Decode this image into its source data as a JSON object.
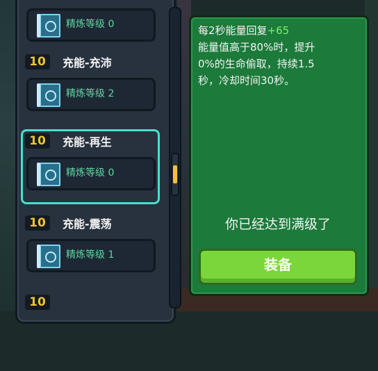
{
  "list": {
    "cards": [
      {
        "level": "",
        "name": "",
        "refine_label": "精炼等级 0"
      },
      {
        "level": "10",
        "name": "充能-充沛",
        "refine_label": "精炼等级 2"
      },
      {
        "level": "10",
        "name": "充能-再生",
        "refine_label": "精炼等级 0"
      },
      {
        "level": "10",
        "name": "充能-震荡",
        "refine_label": "精炼等级 1"
      },
      {
        "level": "10",
        "name": "",
        "refine_label": ""
      }
    ],
    "selected_index": 2
  },
  "detail": {
    "line1_prefix": "每2秒能量回复",
    "line1_gain": "+65",
    "line2": "能量值高于80%时，提升",
    "line3": "0%的生命偷取，持续1.5",
    "line4": "秒，冷却时间30秒。",
    "max_level_text": "你已经达到满级了",
    "equip_label": "装备"
  },
  "colors": {
    "accent_green": "#7bd63c",
    "selected_frame": "#46e0d0",
    "level_yellow": "#f2c233",
    "refine_teal": "#5ed6a0"
  },
  "icons": {
    "blueprint": "blueprint-icon"
  }
}
